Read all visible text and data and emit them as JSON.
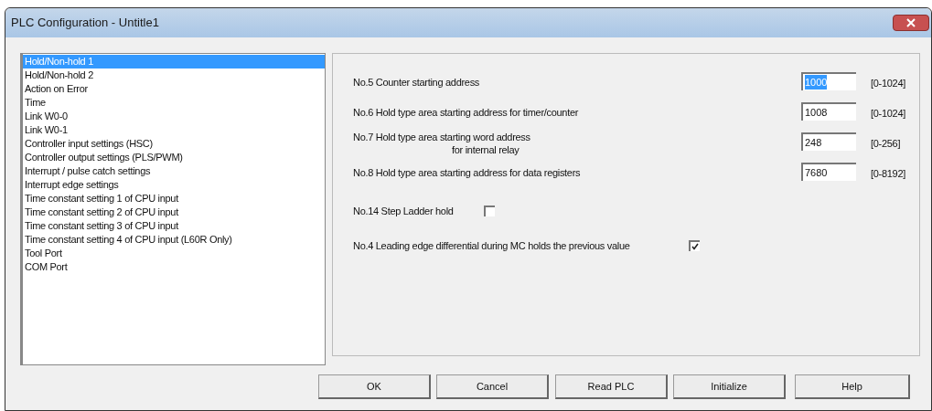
{
  "window": {
    "title": "PLC Configuration - Untitle1"
  },
  "sidebar": {
    "items": [
      {
        "label": "Hold/Non-hold 1",
        "selected": true
      },
      {
        "label": "Hold/Non-hold 2",
        "selected": false
      },
      {
        "label": "Action on Error",
        "selected": false
      },
      {
        "label": "Time",
        "selected": false
      },
      {
        "label": "Link W0-0",
        "selected": false
      },
      {
        "label": "Link W0-1",
        "selected": false
      },
      {
        "label": "Controller input settings (HSC)",
        "selected": false
      },
      {
        "label": "Controller output settings (PLS/PWM)",
        "selected": false
      },
      {
        "label": "Interrupt / pulse catch settings",
        "selected": false
      },
      {
        "label": "Interrupt edge settings",
        "selected": false
      },
      {
        "label": "Time constant setting 1 of CPU input",
        "selected": false
      },
      {
        "label": "Time constant setting 2 of CPU input",
        "selected": false
      },
      {
        "label": "Time constant setting 3 of CPU input",
        "selected": false
      },
      {
        "label": "Time constant setting 4 of CPU input (L60R Only)",
        "selected": false
      },
      {
        "label": "Tool Port",
        "selected": false
      },
      {
        "label": "COM Port",
        "selected": false
      }
    ]
  },
  "settings": [
    {
      "kind": "field",
      "label": "No.5 Counter starting address",
      "value": "1000",
      "value_selected": true,
      "range": "[0-1024]"
    },
    {
      "kind": "field",
      "label": "No.6 Hold type area starting address for timer/counter",
      "value": "1008",
      "value_selected": false,
      "range": "[0-1024]"
    },
    {
      "kind": "field",
      "label": "No.7 Hold type area starting word address",
      "sublabel": "for internal relay",
      "value": "248",
      "value_selected": false,
      "range": "[0-256]"
    },
    {
      "kind": "field",
      "label": "No.8 Hold type area starting address for data registers",
      "value": "7680",
      "value_selected": false,
      "range": "[0-8192]"
    },
    {
      "kind": "checkbox",
      "label": "No.14 Step Ladder hold",
      "checked": false
    },
    {
      "kind": "checkbox",
      "label": "No.4 Leading edge differential during MC holds the previous value",
      "checked": true
    }
  ],
  "buttons": [
    "OK",
    "Cancel",
    "Read PLC",
    "Initialize",
    "Help"
  ]
}
